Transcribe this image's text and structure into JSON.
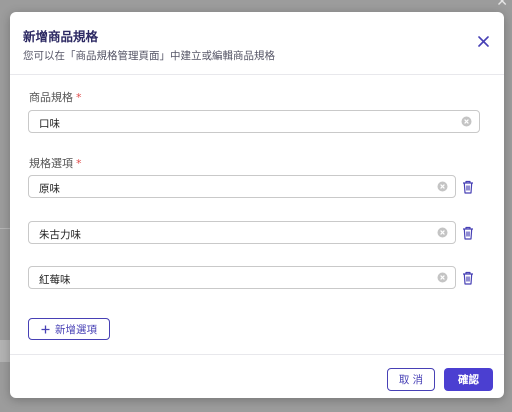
{
  "modal": {
    "title": "新增商品規格",
    "subtitle": "您可以在「商品規格管理頁面」中建立或編輯商品規格"
  },
  "spec_name": {
    "label": "商品規格",
    "required_mark": "*",
    "value": "口味"
  },
  "spec_options": {
    "label": "規格選項",
    "required_mark": "*",
    "items": [
      {
        "value": "原味"
      },
      {
        "value": "朱古力味"
      },
      {
        "value": "紅莓味"
      }
    ],
    "add_button_label": "新增選項"
  },
  "footer": {
    "cancel_label": "取 消",
    "confirm_label": "確認"
  },
  "colors": {
    "accent": "#4b3fd1",
    "title": "#2d2a63",
    "required": "#e04b4b"
  },
  "icons": [
    "close-icon",
    "clear-icon",
    "trash-icon",
    "plus-icon"
  ]
}
